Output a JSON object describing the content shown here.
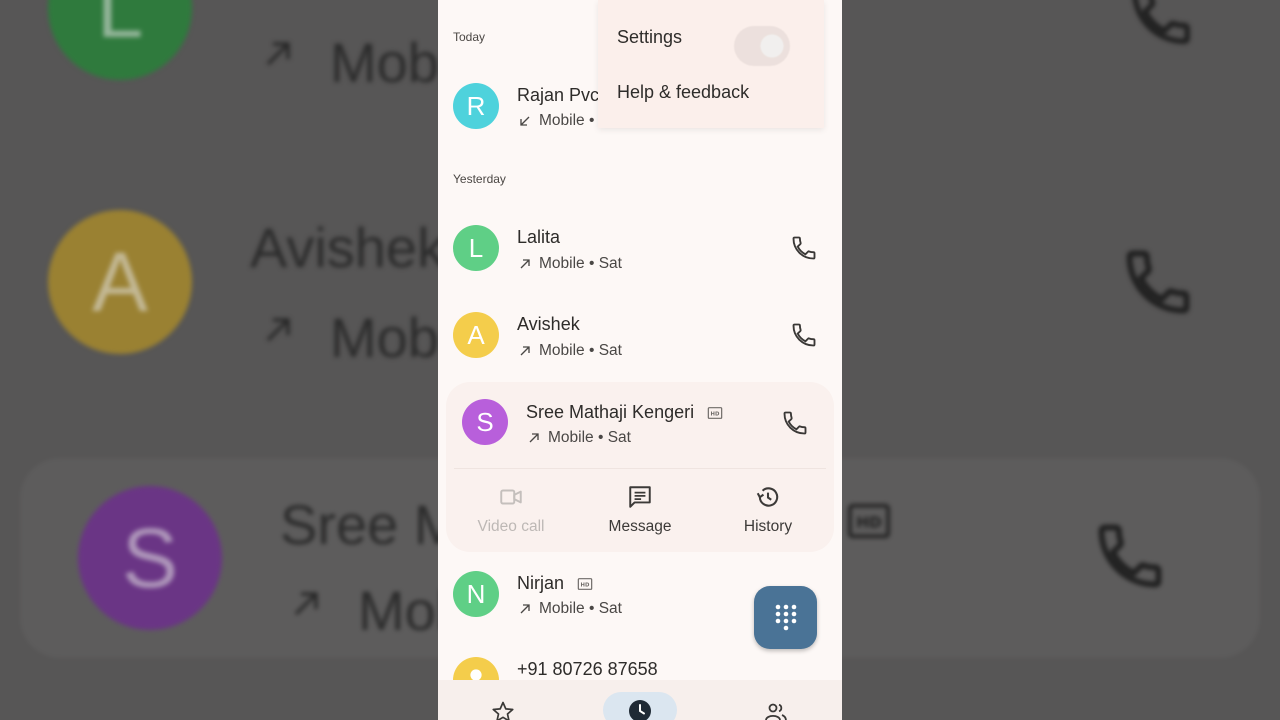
{
  "background": {
    "avatars": [
      "L",
      "A",
      "S"
    ],
    "texts": [
      "Mobi",
      "Avishek",
      "Mobi",
      "Sree M",
      "Mobi"
    ]
  },
  "sections": {
    "today": "Today",
    "yesterday": "Yesterday"
  },
  "menu": {
    "settings": "Settings",
    "help": "Help & feedback"
  },
  "calls": [
    {
      "initial": "R",
      "name": "Rajan Pvc",
      "detail": "Mobile •",
      "direction": "incoming",
      "color": "#4ed2dc"
    },
    {
      "initial": "L",
      "name": "Lalita",
      "detail": "Mobile • Sat",
      "direction": "outgoing",
      "color": "#5fcf86"
    },
    {
      "initial": "A",
      "name": "Avishek",
      "detail": "Mobile • Sat",
      "direction": "outgoing",
      "color": "#f4cd4b"
    },
    {
      "initial": "S",
      "name": "Sree Mathaji Kengeri",
      "detail": "Mobile • Sat",
      "direction": "outgoing",
      "color": "#b85fdb",
      "hd": true
    },
    {
      "initial": "N",
      "name": "Nirjan",
      "detail": "Mobile • Sat",
      "direction": "outgoing",
      "color": "#5fcf86",
      "hd": true
    },
    {
      "initial": "",
      "name": "+91 80726 87658",
      "detail": "",
      "direction": "outgoing",
      "color": "#f4cd4b"
    }
  ],
  "actions": {
    "video_call": "Video call",
    "message": "Message",
    "history": "History"
  },
  "icons": {
    "call": "phone-icon",
    "fab": "dialpad-icon",
    "nav": [
      "star-icon",
      "clock-icon",
      "contacts-icon"
    ]
  },
  "colors": {
    "fab": "#4a7396",
    "nav_active": "#dbe6f0",
    "background": "#fdf8f6"
  }
}
